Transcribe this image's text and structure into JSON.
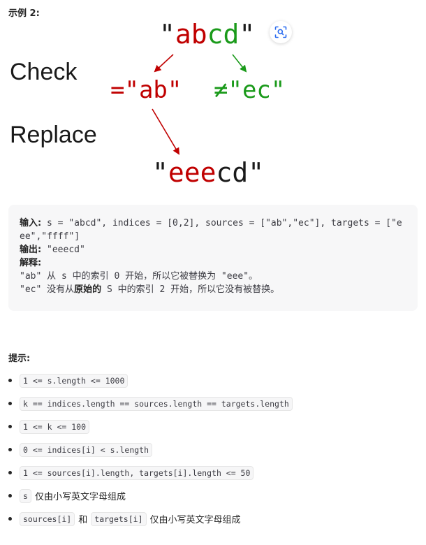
{
  "example": {
    "title": "示例 2:"
  },
  "diagram": {
    "top_quote_open": "\"",
    "top_red": "ab",
    "top_green": "cd",
    "top_quote_close": "\"",
    "check_label": "Check",
    "replace_label": "Replace",
    "match_text": "=\"ab\"",
    "nomatch_text": "≠\"ec\"",
    "result_quote_open": "\"",
    "result_red": "eee",
    "result_black": "cd",
    "result_quote_close": "\"",
    "colors": {
      "red": "#c00000",
      "green": "#1a9a1a",
      "black": "#1a1a1a"
    },
    "lens_icon": "lens-scan-icon"
  },
  "codebox": {
    "input_label": "输入:",
    "input_value": " s = \"abcd\", indices = [0,2], sources = [\"ab\",\"ec\"], targets = [\"eee\",\"ffff\"]",
    "output_label": "输出:",
    "output_value": "\"eeecd\"",
    "explain_label": "解释:",
    "explain_line1": "\"ab\" 从 s 中的索引 0 开始，所以它被替换为 \"eee\"。",
    "explain_line2_a": "\"ec\" 没有从",
    "explain_line2_bold": "原始的",
    "explain_line2_b": " S 中的索引 2 开始，所以它没有被替换。"
  },
  "hints": {
    "title": "提示:",
    "items": [
      {
        "code": "1 <= s.length <= 1000"
      },
      {
        "code": "k == indices.length == sources.length == targets.length"
      },
      {
        "code": "1 <= k <= 100"
      },
      {
        "code": "0 <= indices[i] < s.length"
      },
      {
        "code": "1 <= sources[i].length, targets[i].length <= 50"
      },
      {
        "code": "s",
        "text": "仅由小写英文字母组成"
      },
      {
        "code": "sources[i]",
        "text": "和",
        "code2": "targets[i]",
        "text2": "仅由小写英文字母组成"
      }
    ]
  }
}
